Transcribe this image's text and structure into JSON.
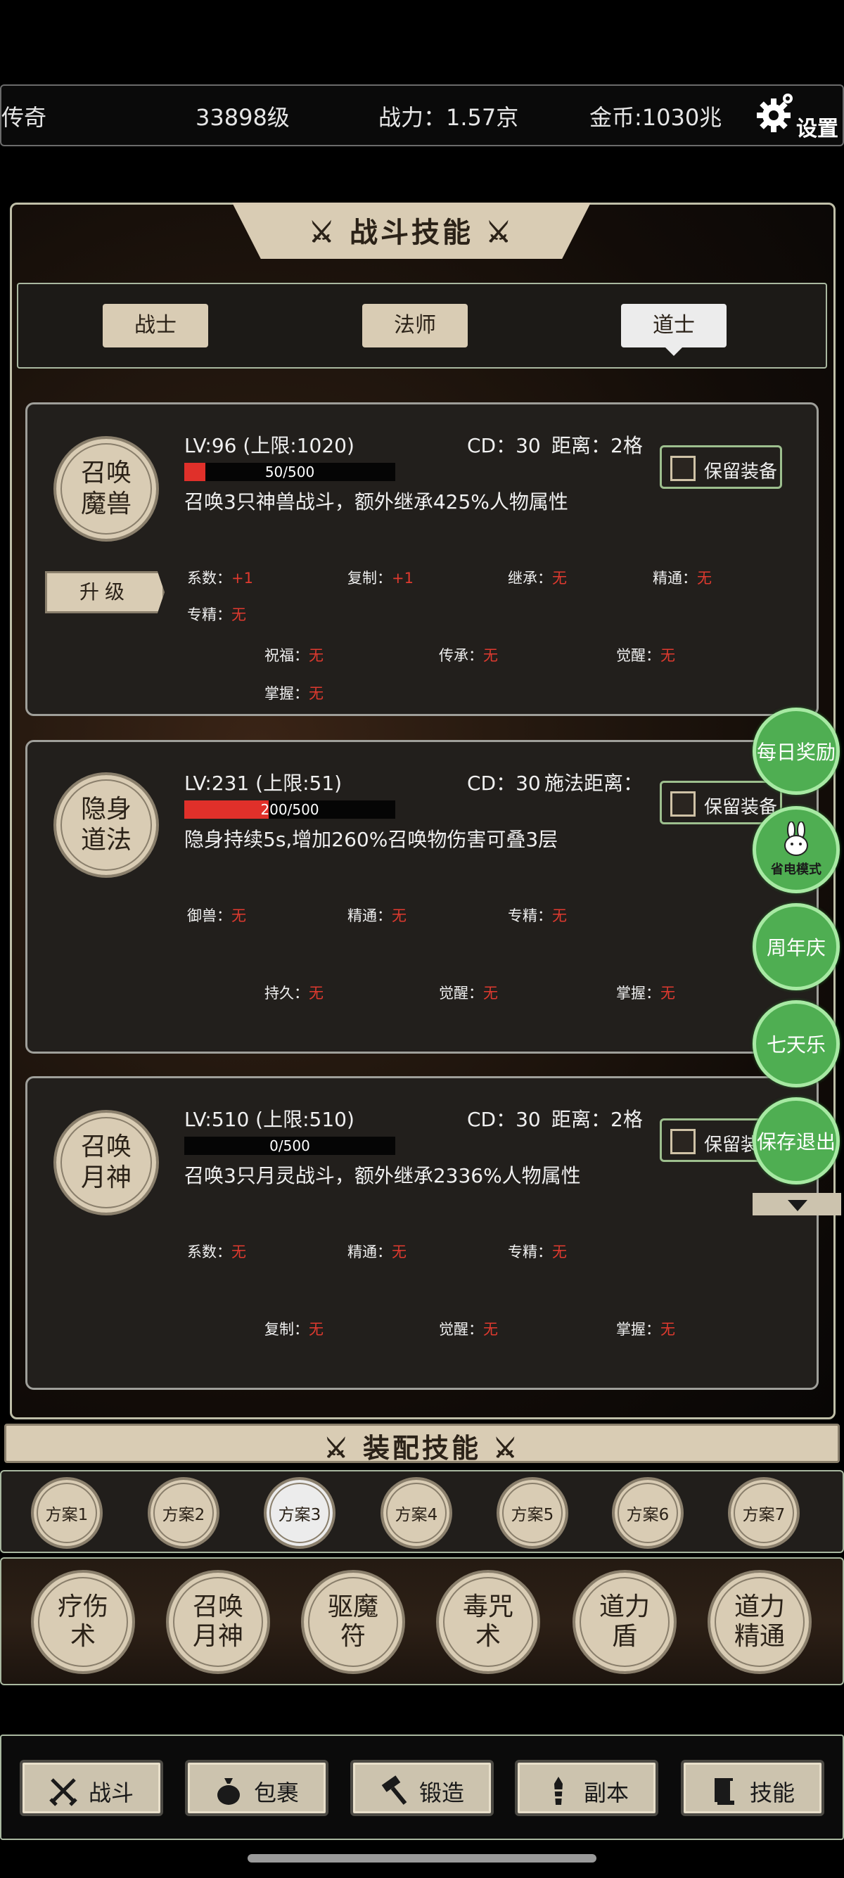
{
  "header": {
    "title": "传奇",
    "level": "33898级",
    "power": "战力：1.57京",
    "gold": "金币:1030兆",
    "settings_label": "设置"
  },
  "battle_skills": {
    "title": "⚔ 战斗技能 ⚔",
    "tabs": [
      {
        "label": "战士",
        "active": false
      },
      {
        "label": "法师",
        "active": false
      },
      {
        "label": "道士",
        "active": true
      }
    ]
  },
  "skills": [
    {
      "name_line1": "召唤",
      "name_line2": "魔兽",
      "lv": "LV:96 (上限:1020)",
      "cd": "CD：30",
      "range": "距离：2格",
      "exp_text": "50/500",
      "exp_fraction": 0.1,
      "desc": "召唤3只神兽战斗，额外继承425%人物属性",
      "keep_label": "保留装备",
      "upgrade_label": "升级",
      "attrs_row1": [
        {
          "k": "系数：",
          "v": "+1"
        },
        {
          "k": "复制：",
          "v": "+1"
        },
        {
          "k": "继承：",
          "v": "无"
        },
        {
          "k": "精通：",
          "v": "无"
        }
      ],
      "attrs_row1b": [
        {
          "k": "专精：",
          "v": "无"
        }
      ],
      "attrs_row2": [
        {
          "k": "祝福：",
          "v": "无"
        },
        {
          "k": "传承：",
          "v": "无"
        },
        {
          "k": "觉醒：",
          "v": "无"
        }
      ],
      "attrs_row2b": [
        {
          "k": "掌握：",
          "v": "无"
        }
      ]
    },
    {
      "name_line1": "隐身",
      "name_line2": "道法",
      "lv": "LV:231 (上限:51)",
      "cd": "CD：30",
      "range": "施法距离：",
      "exp_text": "200/500",
      "exp_fraction": 0.4,
      "desc": "隐身持续5s,增加260%召唤物伤害可叠3层",
      "keep_label": "保留装备",
      "attrs_row1": [
        {
          "k": "御兽：",
          "v": "无"
        },
        {
          "k": "精通：",
          "v": "无"
        },
        {
          "k": "专精：",
          "v": "无"
        }
      ],
      "attrs_row2": [
        {
          "k": "持久：",
          "v": "无"
        },
        {
          "k": "觉醒：",
          "v": "无"
        },
        {
          "k": "掌握：",
          "v": "无"
        }
      ]
    },
    {
      "name_line1": "召唤",
      "name_line2": "月神",
      "lv": "LV:510 (上限:510)",
      "cd": "CD：30",
      "range": "距离：2格",
      "exp_text": "0/500",
      "exp_fraction": 0,
      "desc": "召唤3只月灵战斗，额外继承2336%人物属性",
      "keep_label": "保留装备",
      "attrs_row1": [
        {
          "k": "系数：",
          "v": "无"
        },
        {
          "k": "精通：",
          "v": "无"
        },
        {
          "k": "专精：",
          "v": "无"
        }
      ],
      "attrs_row2": [
        {
          "k": "复制：",
          "v": "无"
        },
        {
          "k": "觉醒：",
          "v": "无"
        },
        {
          "k": "掌握：",
          "v": "无"
        }
      ]
    }
  ],
  "floating": {
    "daily": "每日奖励",
    "power_save": "省电模式",
    "anniversary": "周年庆",
    "seven_days": "七天乐",
    "save_exit": "保存退出"
  },
  "equip": {
    "title": "⚔ 装配技能 ⚔",
    "plans": [
      {
        "label": "方案1",
        "active": false
      },
      {
        "label": "方案2",
        "active": false
      },
      {
        "label": "方案3",
        "active": true
      },
      {
        "label": "方案4",
        "active": false
      },
      {
        "label": "方案5",
        "active": false
      },
      {
        "label": "方案6",
        "active": false
      },
      {
        "label": "方案7",
        "active": false
      }
    ],
    "skills": [
      {
        "l1": "疗伤",
        "l2": "术"
      },
      {
        "l1": "召唤",
        "l2": "月神"
      },
      {
        "l1": "驱魔",
        "l2": "符"
      },
      {
        "l1": "毒咒",
        "l2": "术"
      },
      {
        "l1": "道力",
        "l2": "盾"
      },
      {
        "l1": "道力",
        "l2": "精通"
      }
    ]
  },
  "nav": [
    {
      "label": "战斗",
      "icon": "crossed-swords-icon"
    },
    {
      "label": "包裹",
      "icon": "bag-icon"
    },
    {
      "label": "锻造",
      "icon": "hammer-icon"
    },
    {
      "label": "副本",
      "icon": "tower-icon"
    },
    {
      "label": "技能",
      "icon": "book-icon"
    }
  ],
  "colors": {
    "accent_red": "#e03a2f",
    "parchment": "#d9ccb4",
    "float_green": "#4fae52"
  }
}
